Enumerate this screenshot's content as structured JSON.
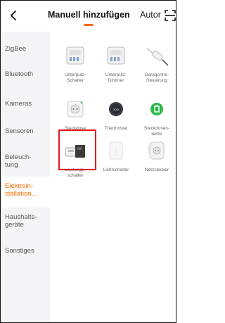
{
  "header": {
    "tab_manual": "Manuell hinzufügen",
    "tab_auto": "Autor"
  },
  "sidebar": {
    "items": [
      {
        "label_1": "ZigBee",
        "label_2": ""
      },
      {
        "label_1": "Bluetooth",
        "label_2": ""
      },
      {
        "label_1": "Kameras",
        "label_2": ""
      },
      {
        "label_1": "Sensoren",
        "label_2": ""
      },
      {
        "label_1": "Beleuch-",
        "label_2": "tung"
      },
      {
        "label_1": "Elektroin-",
        "label_2": "stallation..."
      },
      {
        "label_1": "Haushalts-",
        "label_2": "geräte"
      },
      {
        "label_1": "Sonstiges",
        "label_2": ""
      }
    ],
    "selected": "Elektroin-stallation..."
  },
  "devices": [
    {
      "l1": "Unterputz-",
      "l2": "Schalter"
    },
    {
      "l1": "Unterputz-",
      "l2": "Dimmer"
    },
    {
      "l1": "Garagentor-",
      "l2": "Steuerung"
    },
    {
      "l1": "Steckdose",
      "l2": ""
    },
    {
      "l1": "Thermostat",
      "l2": ""
    },
    {
      "l1": "Steckdosen-",
      "l2": "leiste"
    },
    {
      "l1": "Leistungs-",
      "l2": "schalter"
    },
    {
      "l1": "Lichtschalter",
      "l2": ""
    },
    {
      "l1": "Netzstecker",
      "l2": ""
    }
  ],
  "thermostat_display": "20.5",
  "colors": {
    "accent": "#ff6a00",
    "highlight": "#e8151b",
    "sidebar_bg": "#f4f4f6",
    "plug_green": "#2db84c"
  }
}
